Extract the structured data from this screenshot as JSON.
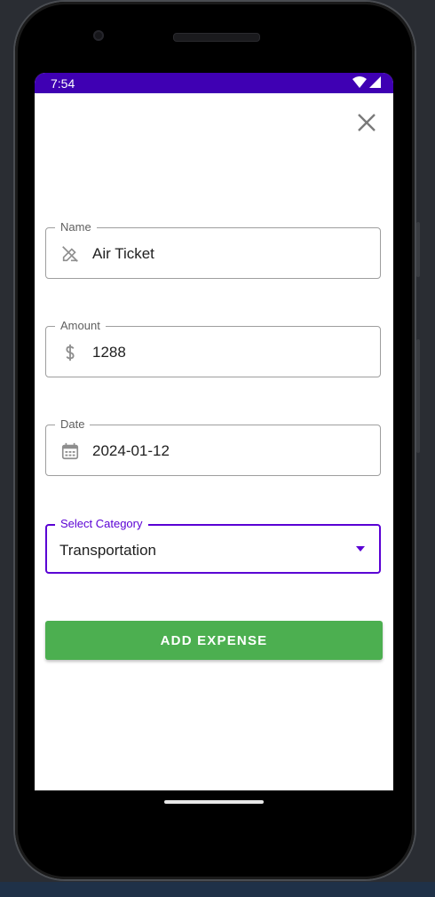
{
  "status_bar": {
    "time": "7:54"
  },
  "form": {
    "name": {
      "label": "Name",
      "value": "Air Ticket",
      "icon": "edit-off-icon"
    },
    "amount": {
      "label": "Amount",
      "value": "1288",
      "icon": "dollar-icon"
    },
    "date": {
      "label": "Date",
      "value": "2024-01-12",
      "icon": "calendar-icon"
    },
    "category": {
      "label": "Select Category",
      "value": "Transportation"
    }
  },
  "actions": {
    "add_label": "ADD EXPENSE"
  },
  "colors": {
    "status_bar": "#3f00b3",
    "accent": "#5a00d4",
    "add_button": "#4caf50"
  }
}
